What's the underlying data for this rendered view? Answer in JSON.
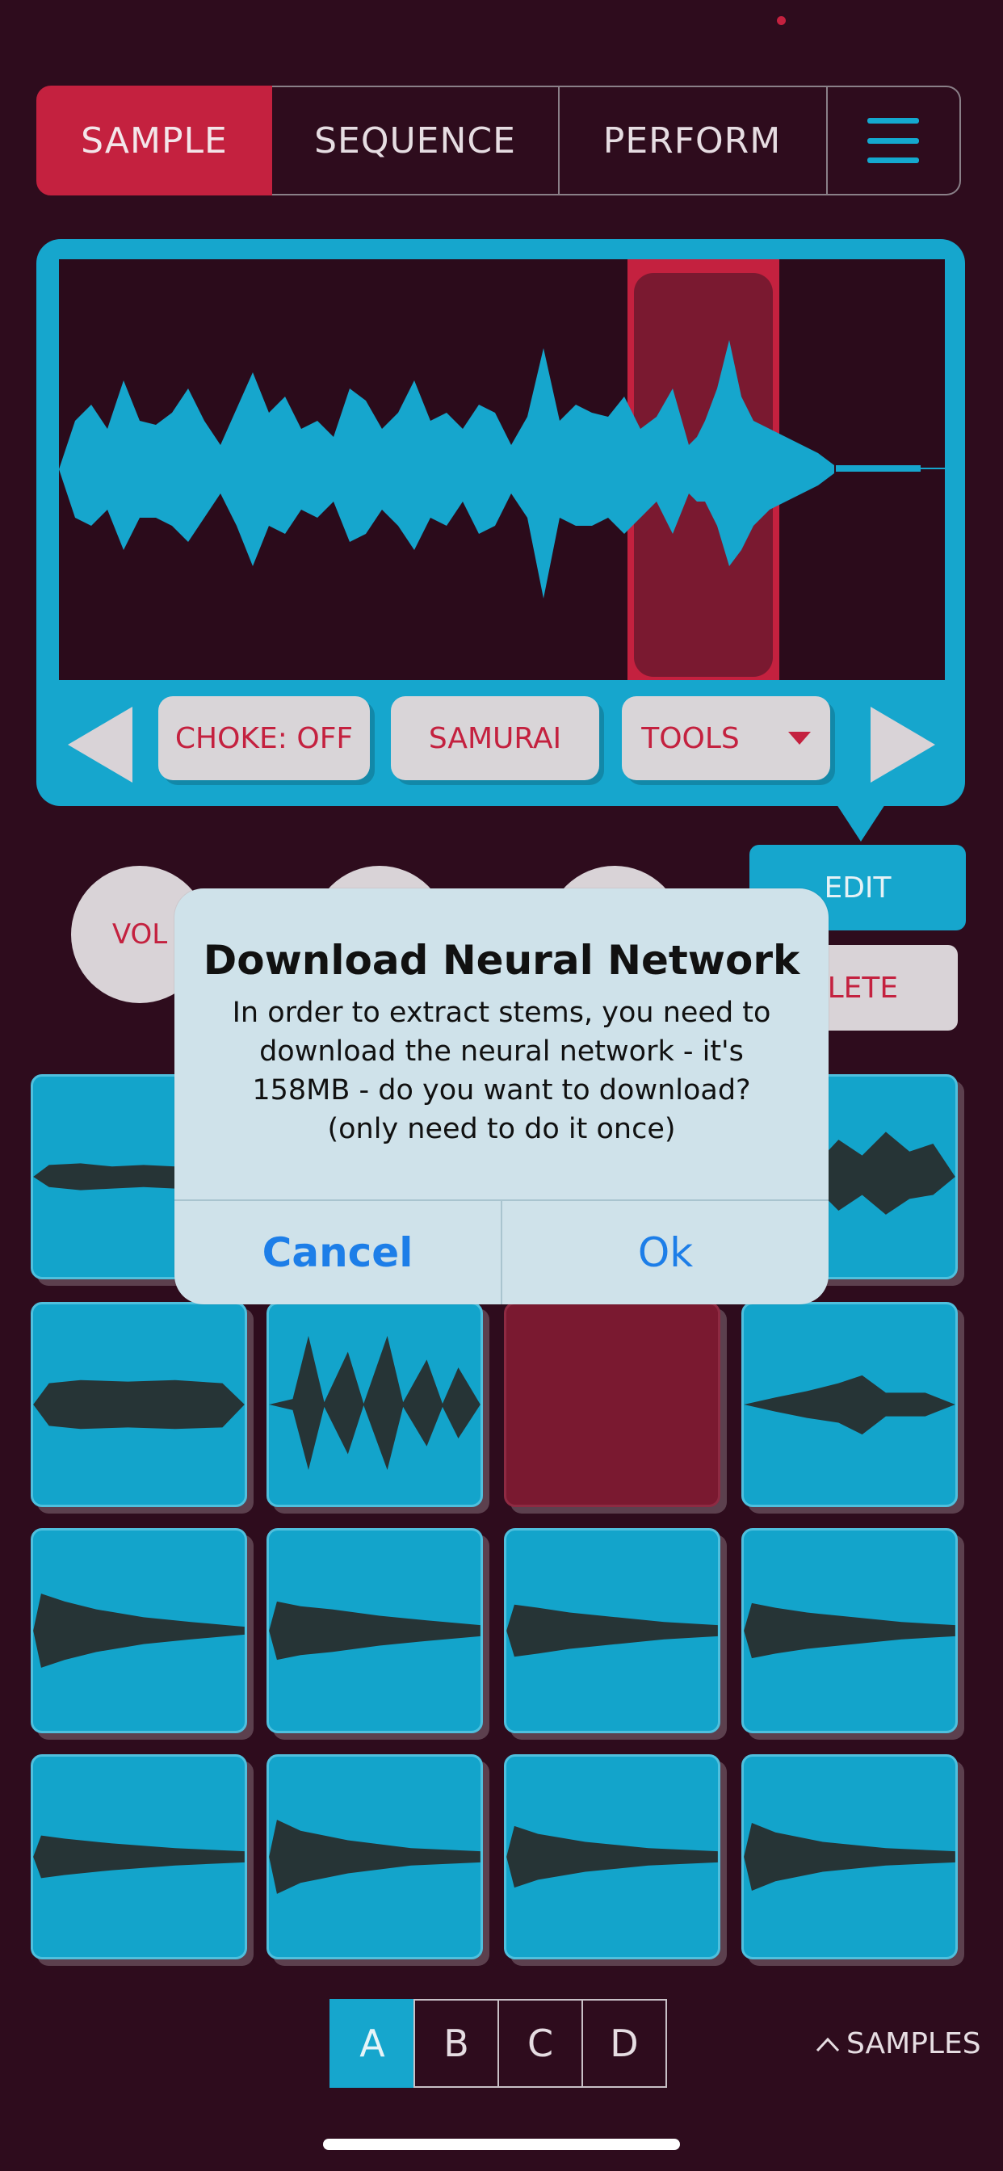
{
  "tabs": [
    {
      "label": "SAMPLE",
      "active": true
    },
    {
      "label": "SEQUENCE",
      "active": false
    },
    {
      "label": "PERFORM",
      "active": false
    }
  ],
  "menu_icon": "hamburger-menu-icon",
  "editor": {
    "choke_label": "CHOKE: OFF",
    "preset_label": "SAMURAI",
    "tools_label": "TOOLS",
    "colors": {
      "accent": "#16a6cd",
      "selection": "#c4213f",
      "background": "#2e0c1d"
    }
  },
  "knobs": [
    {
      "label": "VOL"
    },
    {
      "label": ""
    },
    {
      "label": ""
    }
  ],
  "side_buttons": {
    "edit": "EDIT",
    "delete": "ELETE"
  },
  "banks": [
    "A",
    "B",
    "C",
    "D"
  ],
  "active_bank": "A",
  "samples_link": "SAMPLES",
  "dialog": {
    "title": "Download Neural Network",
    "message": "In order to extract stems, you need to\ndownload the neural network - it's\n158MB - do you want to download?\n(only need to do it once)",
    "cancel": "Cancel",
    "ok": "Ok"
  }
}
